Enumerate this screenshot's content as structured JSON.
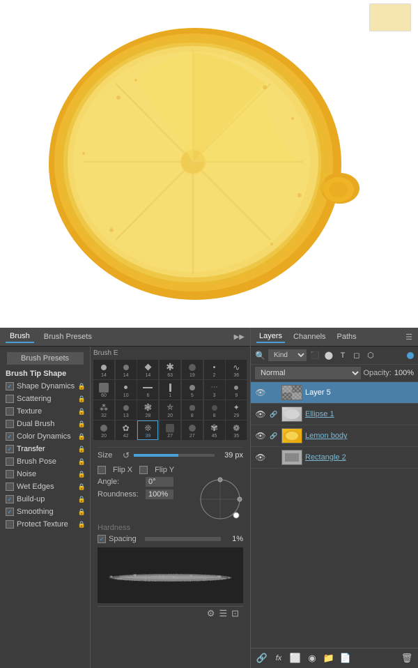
{
  "canvas": {
    "background": "#ffffff"
  },
  "brush_panel": {
    "title": "Brush",
    "tab1": "Brush",
    "tab2": "Brush Presets",
    "presets_button": "Brush Presets",
    "sidebar_items": [
      {
        "label": "Brush Tip Shape",
        "checkbox": false,
        "lock": false,
        "type": "header"
      },
      {
        "label": "Shape Dynamics",
        "checkbox": true,
        "lock": true
      },
      {
        "label": "Scattering",
        "checkbox": false,
        "lock": true
      },
      {
        "label": "Texture",
        "checkbox": false,
        "lock": true
      },
      {
        "label": "Dual Brush",
        "checkbox": false,
        "lock": true
      },
      {
        "label": "Color Dynamics",
        "checkbox": true,
        "lock": true
      },
      {
        "label": "Transfer",
        "checkbox": true,
        "lock": true
      },
      {
        "label": "Brush Pose",
        "checkbox": false,
        "lock": true
      },
      {
        "label": "Noise",
        "checkbox": false,
        "lock": true
      },
      {
        "label": "Wet Edges",
        "checkbox": false,
        "lock": true
      },
      {
        "label": "Build-up",
        "checkbox": true,
        "lock": true
      },
      {
        "label": "Smoothing",
        "checkbox": true,
        "lock": true
      },
      {
        "label": "Protect Texture",
        "checkbox": false,
        "lock": true
      }
    ],
    "current_brush": "Brush E",
    "size_label": "Size",
    "size_value": "39 px",
    "flip_x": "Flip X",
    "flip_y": "Flip Y",
    "angle_label": "Angle:",
    "angle_value": "0°",
    "roundness_label": "Roundness:",
    "roundness_value": "100%",
    "hardness_label": "Hardness",
    "spacing_label": "Spacing",
    "spacing_value": "1%",
    "grid_numbers": [
      "14",
      "14",
      "14",
      "63",
      "19",
      "2",
      "36",
      "60",
      "10",
      "6",
      "1",
      "5",
      "3",
      "9",
      "32",
      "13",
      "28",
      "20",
      "8",
      "8",
      "29",
      "20",
      "42",
      "39",
      "27",
      "27",
      "45",
      "35"
    ]
  },
  "layers_panel": {
    "title": "Layers",
    "tab1": "Layers",
    "tab2": "Channels",
    "tab3": "Paths",
    "kind_label": "Kind",
    "blend_mode": "Normal",
    "opacity_label": "Opacity:",
    "opacity_value": "100%",
    "layers": [
      {
        "name": "Layer 5",
        "visible": true,
        "linked": false,
        "type": "normal",
        "selected": true
      },
      {
        "name": "Ellipse 1",
        "visible": true,
        "linked": false,
        "type": "shape",
        "selected": false
      },
      {
        "name": "Lemon body",
        "visible": true,
        "linked": true,
        "type": "normal",
        "selected": false
      },
      {
        "name": "Rectangle 2",
        "visible": true,
        "linked": false,
        "type": "shape",
        "selected": false
      }
    ],
    "bottom_icons": [
      "link",
      "fx",
      "mask",
      "adjustment",
      "folder",
      "new",
      "trash"
    ]
  }
}
